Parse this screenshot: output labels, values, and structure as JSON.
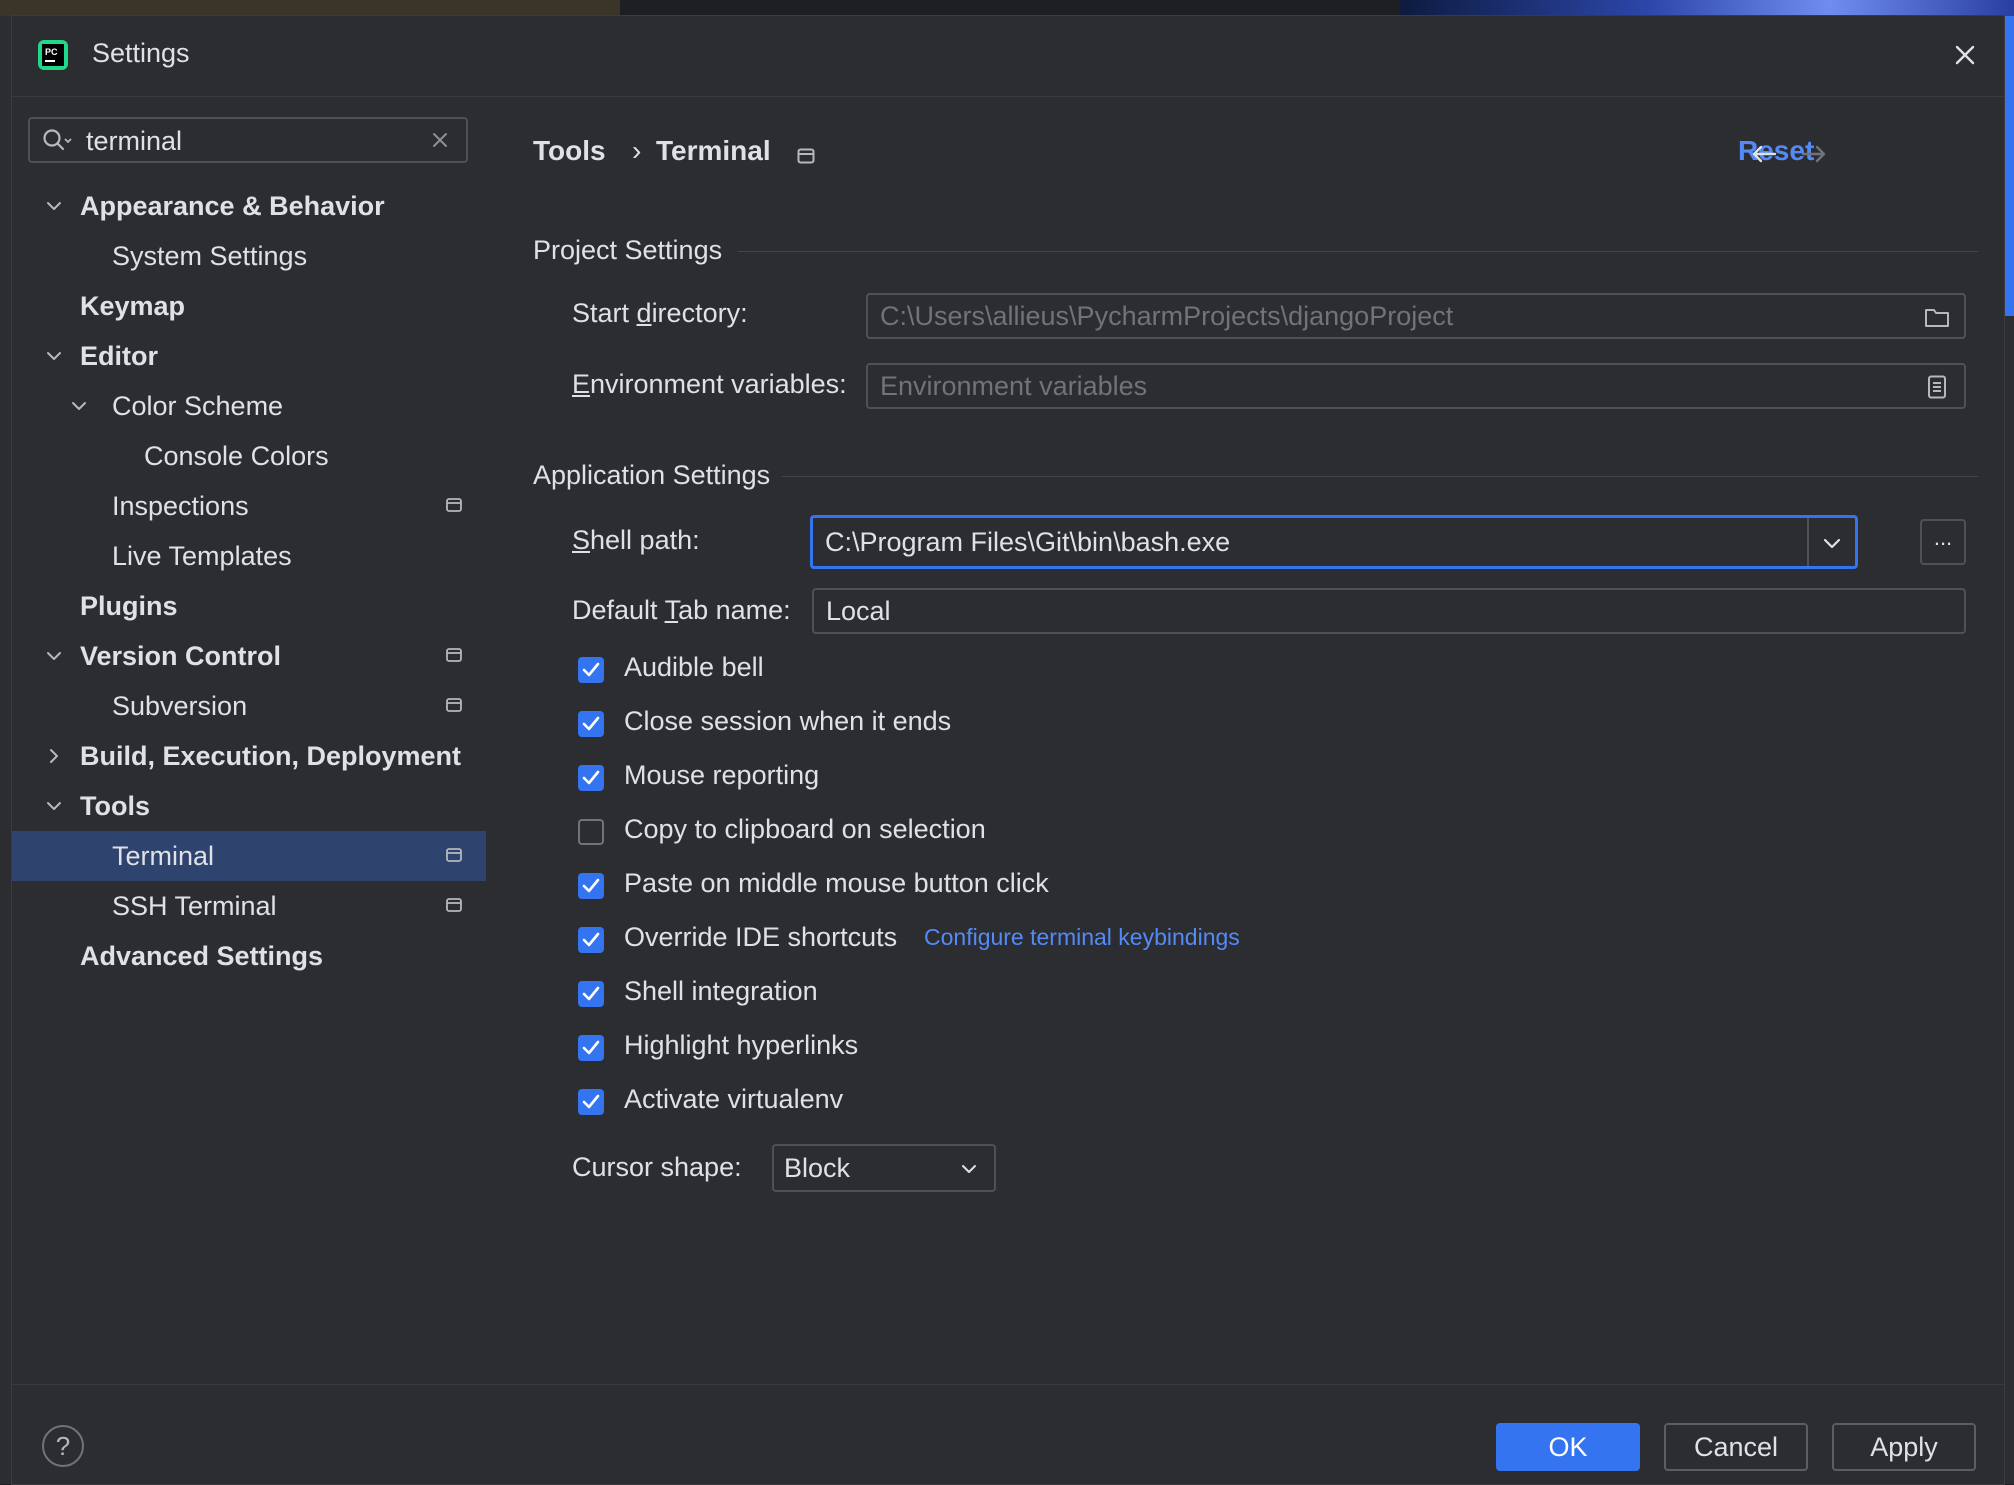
{
  "window": {
    "title": "Settings"
  },
  "search": {
    "value": "terminal"
  },
  "sidebar": {
    "items": [
      {
        "label": "Appearance & Behavior",
        "level": 0,
        "chevron": "down",
        "bold": true,
        "pinned": false
      },
      {
        "label": "System Settings",
        "level": 1,
        "chevron": "none",
        "bold": false,
        "pinned": false
      },
      {
        "label": "Keymap",
        "level": 0,
        "chevron": "none",
        "bold": true,
        "pinned": false
      },
      {
        "label": "Editor",
        "level": 0,
        "chevron": "down",
        "bold": true,
        "pinned": false
      },
      {
        "label": "Color Scheme",
        "level": 1,
        "chevron": "down",
        "bold": false,
        "pinned": false
      },
      {
        "label": "Console Colors",
        "level": 2,
        "chevron": "none",
        "bold": false,
        "pinned": false
      },
      {
        "label": "Inspections",
        "level": 1,
        "chevron": "none",
        "bold": false,
        "pinned": true
      },
      {
        "label": "Live Templates",
        "level": 1,
        "chevron": "none",
        "bold": false,
        "pinned": false
      },
      {
        "label": "Plugins",
        "level": 0,
        "chevron": "none",
        "bold": true,
        "pinned": false
      },
      {
        "label": "Version Control",
        "level": 0,
        "chevron": "down",
        "bold": true,
        "pinned": true
      },
      {
        "label": "Subversion",
        "level": 1,
        "chevron": "none",
        "bold": false,
        "pinned": true
      },
      {
        "label": "Build, Execution, Deployment",
        "level": 0,
        "chevron": "right",
        "bold": true,
        "pinned": false
      },
      {
        "label": "Tools",
        "level": 0,
        "chevron": "down",
        "bold": true,
        "pinned": false
      },
      {
        "label": "Terminal",
        "level": 1,
        "chevron": "none",
        "bold": false,
        "pinned": true,
        "selected": true
      },
      {
        "label": "SSH Terminal",
        "level": 1,
        "chevron": "none",
        "bold": false,
        "pinned": true
      },
      {
        "label": "Advanced Settings",
        "level": 0,
        "chevron": "none",
        "bold": true,
        "pinned": false
      }
    ]
  },
  "header": {
    "breadcrumb": [
      "Tools",
      "Terminal"
    ],
    "separator": "›",
    "reset_label": "Reset"
  },
  "project_settings": {
    "title": "Project Settings",
    "start_directory": {
      "label_pre": "Start ",
      "label_u": "d",
      "label_post": "irectory:",
      "value": "C:\\Users\\allieus\\PycharmProjects\\djangoProject"
    },
    "env_vars": {
      "label_pre": "",
      "label_u": "E",
      "label_post": "nvironment variables:",
      "placeholder": "Environment variables"
    }
  },
  "application_settings": {
    "title": "Application Settings",
    "shell_path": {
      "label_pre": "",
      "label_u": "S",
      "label_post": "hell path:",
      "value": "C:\\Program Files\\Git\\bin\\bash.exe",
      "more_label": "..."
    },
    "default_tab": {
      "label_pre": "Default ",
      "label_u": "T",
      "label_post": "ab name:",
      "value": "Local"
    },
    "checkboxes": [
      {
        "label": "Audible bell",
        "checked": true
      },
      {
        "label": "Close session when it ends",
        "checked": true
      },
      {
        "label": "Mouse reporting",
        "checked": true
      },
      {
        "label": "Copy to clipboard on selection",
        "checked": false
      },
      {
        "label": "Paste on middle mouse button click",
        "checked": true
      },
      {
        "label": "Override IDE shortcuts",
        "checked": true,
        "link": "Configure terminal keybindings"
      },
      {
        "label": "Shell integration",
        "checked": true
      },
      {
        "label": "Highlight hyperlinks",
        "checked": true
      },
      {
        "label": "Activate virtualenv",
        "checked": true
      }
    ],
    "cursor_shape": {
      "label": "Cursor shape:",
      "value": "Block"
    }
  },
  "footer": {
    "help_label": "?",
    "ok_label": "OK",
    "cancel_label": "Cancel",
    "apply_label": "Apply"
  },
  "colors": {
    "accent": "#3574f0",
    "link": "#548af7",
    "selection": "#2e436e",
    "background": "#2b2d30"
  },
  "icons": {
    "app": "pycharm-icon",
    "close": "close-icon",
    "search": "search-icon",
    "clear": "clear-icon",
    "pin": "project-scope-icon",
    "folder": "folder-icon",
    "env": "document-icon",
    "dropdown": "chevron-down-icon",
    "back": "arrow-left-icon",
    "forward": "arrow-right-icon"
  }
}
